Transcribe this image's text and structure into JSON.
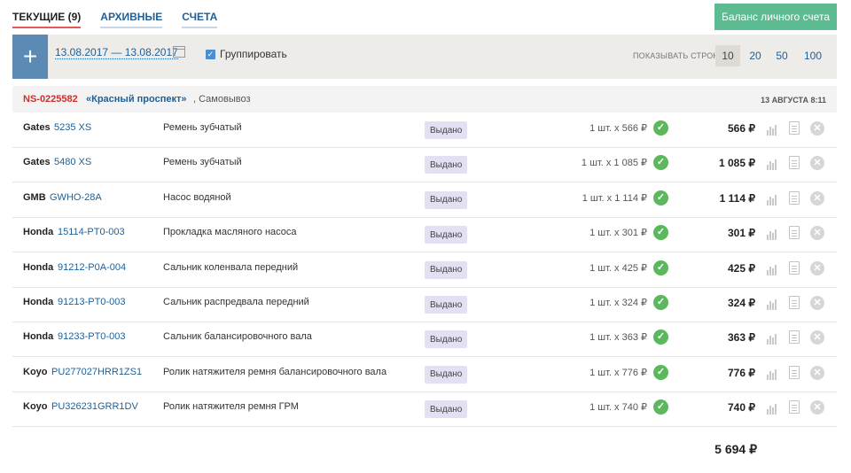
{
  "tabs": {
    "current": "ТЕКУЩИЕ",
    "current_count": "(9)",
    "archive": "АРХИВНЫЕ",
    "invoices": "СЧЕТА"
  },
  "balance_button": "Баланс личного счета",
  "toolbar": {
    "add_label": "+",
    "date_range": "13.08.2017 — 13.08.2017",
    "group_checked": true,
    "group_label": "Группировать",
    "rows_label": "Показывать строк:",
    "rows_options": [
      "10",
      "20",
      "50",
      "100"
    ],
    "rows_selected": "10"
  },
  "order": {
    "id": "NS-0225582",
    "shop": "«Красный проспект»",
    "delivery": ", Самовывоз",
    "date": "13 АВГУСТА 8:11"
  },
  "status_color": "#e3e0f3",
  "ok_color": "#5cb85c",
  "items": [
    {
      "brand": "Gates",
      "part": "5235 XS",
      "desc": "Ремень зубчатый",
      "status": "Выдано",
      "qty": "1 шт. x 566 ₽",
      "price": "566 ₽"
    },
    {
      "brand": "Gates",
      "part": "5480 XS",
      "desc": "Ремень зубчатый",
      "status": "Выдано",
      "qty": "1 шт. x 1 085 ₽",
      "price": "1 085 ₽"
    },
    {
      "brand": "GMB",
      "part": "GWHO-28A",
      "desc": "Насос водяной",
      "status": "Выдано",
      "qty": "1 шт. x 1 114 ₽",
      "price": "1 114 ₽"
    },
    {
      "brand": "Honda",
      "part": "15114-PT0-003",
      "desc": "Прокладка масляного насоса",
      "status": "Выдано",
      "qty": "1 шт. x 301 ₽",
      "price": "301 ₽"
    },
    {
      "brand": "Honda",
      "part": "91212-P0A-004",
      "desc": "Сальник коленвала передний",
      "status": "Выдано",
      "qty": "1 шт. x 425 ₽",
      "price": "425 ₽"
    },
    {
      "brand": "Honda",
      "part": "91213-PT0-003",
      "desc": "Сальник распредвала передний",
      "status": "Выдано",
      "qty": "1 шт. x 324 ₽",
      "price": "324 ₽"
    },
    {
      "brand": "Honda",
      "part": "91233-PT0-003",
      "desc": "Сальник балансировочного вала",
      "status": "Выдано",
      "qty": "1 шт. x 363 ₽",
      "price": "363 ₽"
    },
    {
      "brand": "Koyo",
      "part": "PU277027HRR1ZS1",
      "desc": "Ролик натяжителя ремня балансировочного вала",
      "status": "Выдано",
      "qty": "1 шт. x 776 ₽",
      "price": "776 ₽"
    },
    {
      "brand": "Koyo",
      "part": "PU326231GRR1DV",
      "desc": "Ролик натяжителя ремня ГРМ",
      "status": "Выдано",
      "qty": "1 шт. x 740 ₽",
      "price": "740 ₽"
    }
  ],
  "total": "5 694 ₽"
}
